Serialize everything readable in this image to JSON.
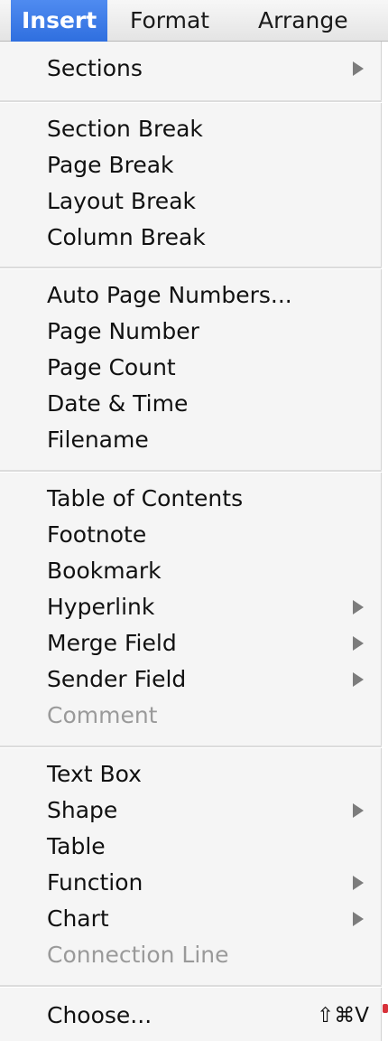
{
  "menubar": {
    "items": [
      {
        "label": "Insert"
      },
      {
        "label": "Format"
      },
      {
        "label": "Arrange"
      }
    ]
  },
  "menu": {
    "sections_label": "Sections",
    "section_break_label": "Section Break",
    "page_break_label": "Page Break",
    "layout_break_label": "Layout Break",
    "column_break_label": "Column Break",
    "auto_page_numbers_label": "Auto Page Numbers...",
    "page_number_label": "Page Number",
    "page_count_label": "Page Count",
    "date_time_label": "Date & Time",
    "filename_label": "Filename",
    "table_of_contents_label": "Table of Contents",
    "footnote_label": "Footnote",
    "bookmark_label": "Bookmark",
    "hyperlink_label": "Hyperlink",
    "merge_field_label": "Merge Field",
    "sender_field_label": "Sender Field",
    "comment_label": "Comment",
    "text_box_label": "Text Box",
    "shape_label": "Shape",
    "table_label": "Table",
    "function_label": "Function",
    "chart_label": "Chart",
    "connection_line_label": "Connection Line",
    "choose_label": "Choose...",
    "choose_shortcut": "⇧⌘V"
  }
}
